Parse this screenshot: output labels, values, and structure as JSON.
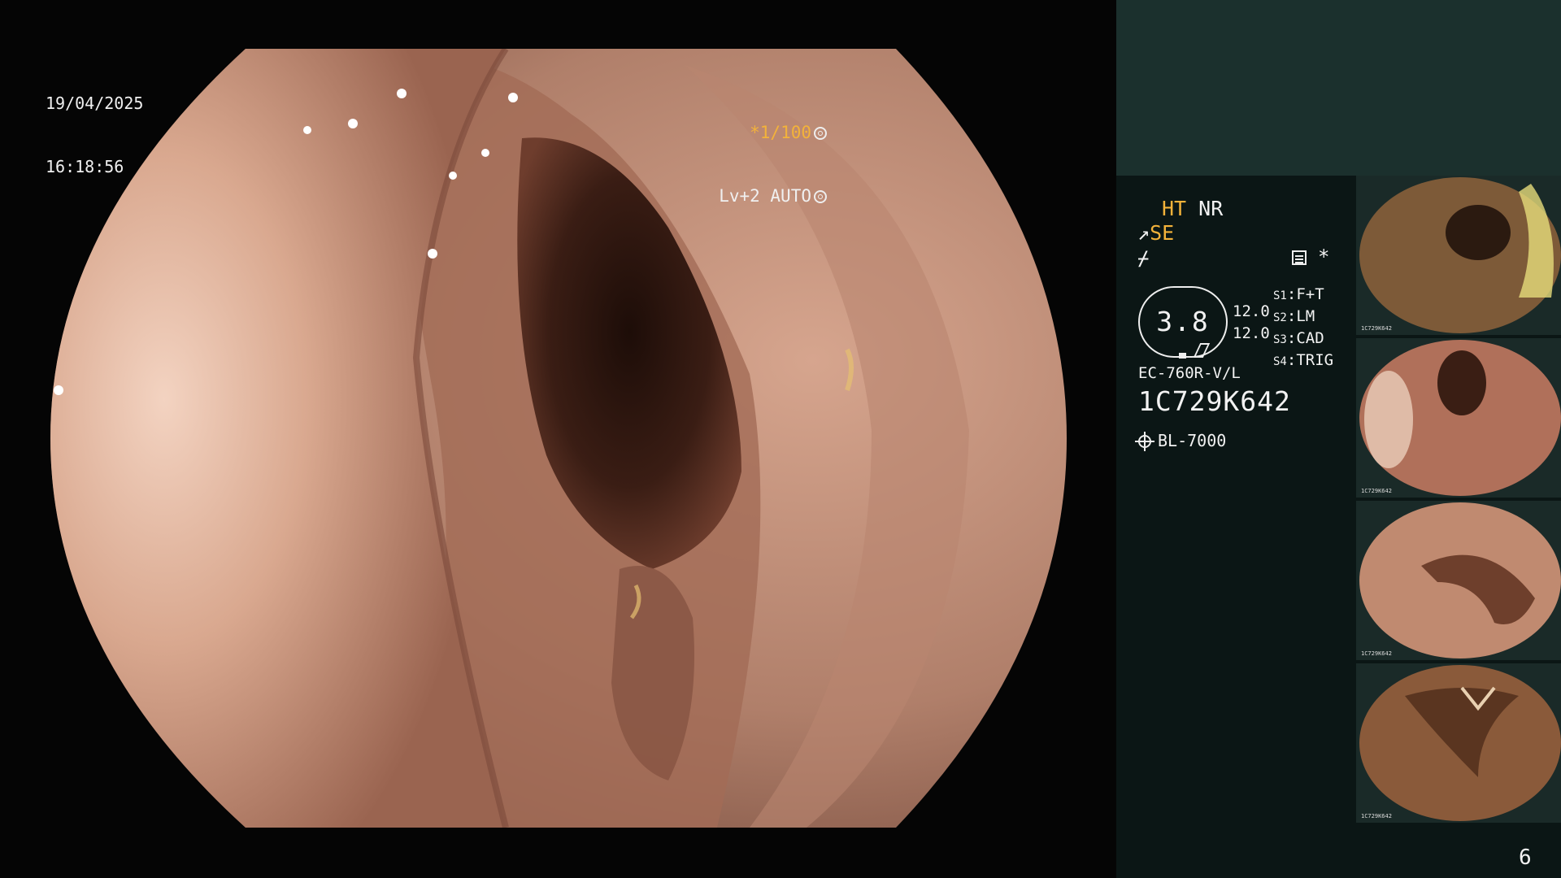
{
  "overlay": {
    "date": "19/04/2025",
    "time": "16:18:56",
    "shutter_prefix": "*1/100",
    "level": "Lv+2 AUTO"
  },
  "panel": {
    "ht": "HT",
    "nr": "NR",
    "se": "SE",
    "nf_symbol": "⌿",
    "star": "*",
    "zoom": "3.8",
    "zoom_values": [
      "12.0",
      "12.0"
    ],
    "scenes": [
      {
        "key": "S1",
        "value": "F+T"
      },
      {
        "key": "S2",
        "value": "LM"
      },
      {
        "key": "S3",
        "value": "CAD"
      },
      {
        "key": "S4",
        "value": "TRIG"
      }
    ],
    "model": "EC-760R-V/L",
    "serial": "1C729K642",
    "light_source": "BL-7000",
    "page": "6"
  },
  "thumbnails": [
    {
      "index": 1,
      "serial": "1C729K642"
    },
    {
      "index": 2,
      "serial": "1C729K642"
    },
    {
      "index": 3,
      "serial": "1C729K642"
    },
    {
      "index": 4,
      "serial": "1C729K642"
    }
  ],
  "colors": {
    "amber": "#f3b23a",
    "panel_top": "#1b302d",
    "panel_bg": "#0b1615",
    "tissue": "#c8927a"
  },
  "icons": [
    "shutter-ring-icon",
    "level-ring-icon",
    "structure-icon",
    "light-source-icon"
  ]
}
